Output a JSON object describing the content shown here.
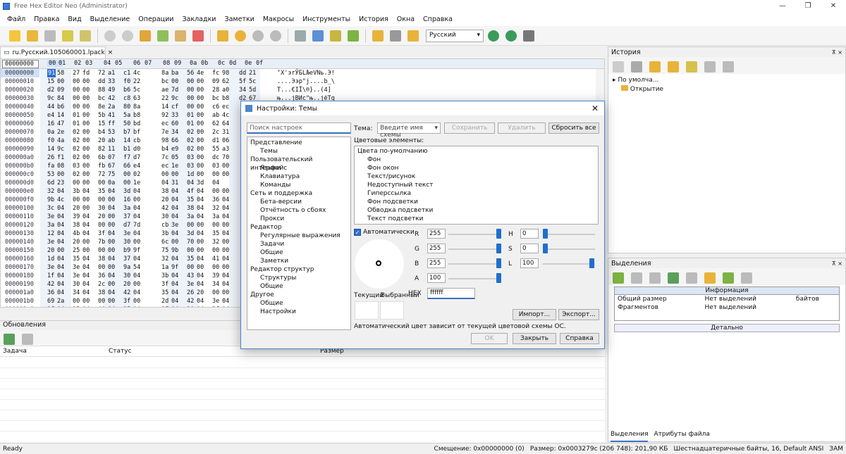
{
  "window": {
    "title": "Free Hex Editor Neo (Administrator)"
  },
  "menu": [
    "Файл",
    "Правка",
    "Вид",
    "Выделение",
    "Операции",
    "Закладки",
    "Заметки",
    "Макросы",
    "Инструменты",
    "История",
    "Окна",
    "Справка"
  ],
  "toolbar": {
    "language": "Русский"
  },
  "doc_tab": {
    "label": "ru.Русский.105060001.lpack",
    "close": "×"
  },
  "hex": {
    "offset_header": "00000000",
    "col_headers": [
      "00",
      "01",
      "02",
      "03",
      "04",
      "05",
      "06",
      "07",
      "08",
      "09",
      "0a",
      "0b",
      "0c",
      "0d",
      "0e",
      "0f"
    ],
    "offsets": [
      "00000000",
      "00000010",
      "00000020",
      "00000030",
      "00000040",
      "00000050",
      "00000060",
      "00000070",
      "00000080",
      "00000090",
      "000000a0",
      "000000b0",
      "000000c0",
      "000000d0",
      "000000e0",
      "000000f0",
      "00000100",
      "00000110",
      "00000120",
      "00000130",
      "00000140",
      "00000150",
      "00000160",
      "00000170",
      "00000180",
      "00000190",
      "000001a0",
      "000001b0",
      "000001c0",
      "000001d0",
      "000001e0"
    ],
    "rows": [
      [
        "91",
        "58",
        "27",
        "fd",
        "72",
        "a1",
        "c1",
        "4c",
        "8a",
        "ba",
        "56",
        "4e",
        "fc",
        "98",
        "dd",
        "21"
      ],
      [
        "15",
        "00",
        "00",
        "00",
        "dd",
        "33",
        "f0",
        "22",
        "bc",
        "00",
        "00",
        "00",
        "09",
        "62",
        "5f",
        "5c"
      ],
      [
        "d2",
        "09",
        "00",
        "00",
        "88",
        "49",
        "b6",
        "5c",
        "ae",
        "7d",
        "00",
        "00",
        "28",
        "a0",
        "34",
        "5d"
      ],
      [
        "9c",
        "84",
        "00",
        "00",
        "bc",
        "42",
        "c8",
        "63",
        "22",
        "9c",
        "00",
        "00",
        "bc",
        "b8",
        "d2",
        "67"
      ],
      [
        "44",
        "b6",
        "00",
        "00",
        "8e",
        "2a",
        "80",
        "8a",
        "14",
        "cf",
        "00",
        "00",
        "c6",
        "ec",
        "",
        "",
        ""
      ],
      [
        "e4",
        "14",
        "01",
        "00",
        "5b",
        "41",
        "5a",
        "b8",
        "92",
        "33",
        "01",
        "00",
        "ab",
        "4c",
        "",
        ""
      ],
      [
        "16",
        "47",
        "01",
        "00",
        "15",
        "ff",
        "50",
        "bd",
        "ec",
        "60",
        "01",
        "00",
        "62",
        "64",
        "",
        ""
      ],
      [
        "0a",
        "2e",
        "02",
        "00",
        "b4",
        "53",
        "b7",
        "bf",
        "7e",
        "34",
        "02",
        "00",
        "2c",
        "31",
        "",
        ""
      ],
      [
        "f0",
        "4a",
        "02",
        "00",
        "20",
        "ab",
        "14",
        "cb",
        "98",
        "66",
        "02",
        "00",
        "d1",
        "06",
        "",
        ""
      ],
      [
        "14",
        "9c",
        "02",
        "00",
        "82",
        "11",
        "b1",
        "d0",
        "b4",
        "e9",
        "02",
        "00",
        "55",
        "a3",
        "",
        ""
      ],
      [
        "26",
        "f1",
        "02",
        "00",
        "6b",
        "07",
        "f7",
        "d7",
        "7c",
        "05",
        "03",
        "00",
        "dc",
        "70",
        "",
        ""
      ],
      [
        "fa",
        "08",
        "03",
        "00",
        "fb",
        "67",
        "66",
        "e4",
        "ec",
        "1e",
        "03",
        "00",
        "03",
        "00",
        "",
        ""
      ],
      [
        "53",
        "00",
        "02",
        "00",
        "72",
        "75",
        "00",
        "02",
        "00",
        "00",
        "1d",
        "00",
        "00",
        "00",
        "",
        ""
      ],
      [
        "6d",
        "23",
        "00",
        "00",
        "00",
        "0a",
        "00",
        "1e",
        "04",
        "31",
        "04",
        "3d",
        "04",
        "",
        ""
      ],
      [
        "32",
        "04",
        "3b",
        "04",
        "35",
        "04",
        "3d",
        "04",
        "38",
        "04",
        "4f",
        "04",
        "00",
        "00",
        "",
        ""
      ],
      [
        "9b",
        "4c",
        "00",
        "00",
        "00",
        "00",
        "16",
        "00",
        "20",
        "04",
        "35",
        "04",
        "36",
        "04",
        "",
        ""
      ],
      [
        "3c",
        "04",
        "20",
        "00",
        "30",
        "04",
        "3a",
        "04",
        "42",
        "04",
        "38",
        "04",
        "32",
        "04",
        "",
        ""
      ],
      [
        "3e",
        "04",
        "39",
        "04",
        "20",
        "00",
        "37",
        "04",
        "30",
        "04",
        "3a",
        "04",
        "3a",
        "04",
        "",
        ""
      ],
      [
        "3a",
        "04",
        "38",
        "04",
        "00",
        "00",
        "d7",
        "7d",
        "cb",
        "3e",
        "00",
        "00",
        "00",
        "00",
        "",
        ""
      ],
      [
        "12",
        "04",
        "4b",
        "04",
        "3f",
        "04",
        "3e",
        "04",
        "3b",
        "04",
        "3d",
        "04",
        "35",
        "04",
        "",
        ""
      ],
      [
        "3e",
        "04",
        "20",
        "00",
        "7b",
        "00",
        "30",
        "00",
        "6c",
        "00",
        "70",
        "00",
        "32",
        "00",
        "",
        ""
      ],
      [
        "20",
        "00",
        "25",
        "00",
        "00",
        "00",
        "b9",
        "9f",
        "75",
        "9b",
        "00",
        "00",
        "00",
        "00",
        "",
        ""
      ],
      [
        "1d",
        "04",
        "35",
        "04",
        "38",
        "04",
        "37",
        "04",
        "32",
        "04",
        "35",
        "04",
        "41",
        "04",
        "",
        ""
      ],
      [
        "3e",
        "04",
        "3e",
        "04",
        "00",
        "00",
        "9a",
        "54",
        "1a",
        "9f",
        "00",
        "00",
        "00",
        "00",
        "",
        ""
      ],
      [
        "1f",
        "04",
        "3e",
        "04",
        "36",
        "04",
        "30",
        "04",
        "3b",
        "04",
        "43",
        "04",
        "39",
        "04",
        "",
        ""
      ],
      [
        "42",
        "04",
        "30",
        "04",
        "2c",
        "00",
        "20",
        "00",
        "3f",
        "04",
        "3e",
        "04",
        "34",
        "04",
        "",
        ""
      ],
      [
        "36",
        "04",
        "34",
        "04",
        "38",
        "04",
        "42",
        "04",
        "35",
        "04",
        "26",
        "20",
        "00",
        "00",
        "",
        ""
      ],
      [
        "69",
        "2a",
        "00",
        "00",
        "00",
        "00",
        "3f",
        "00",
        "2d",
        "04",
        "42",
        "04",
        "3e",
        "04",
        "",
        ""
      ],
      [
        "3f",
        "04",
        "35",
        "04",
        "40",
        "04",
        "35",
        "04",
        "37",
        "04",
        "30",
        "04",
        "3f",
        "04",
        "",
        ""
      ],
      [
        "41",
        "04",
        "42",
        "04",
        "38",
        "04",
        "42",
        "04",
        "20",
        "00",
        "32",
        "04",
        "41",
        "04",
        "",
        ""
      ],
      [
        "1b",
        "04",
        "3e",
        "04",
        "38",
        "04",
        "34",
        "04",
        "20",
        "00",
        "32",
        "04",
        "42",
        "04",
        "",
        ""
      ]
    ],
    "text": [
      "‘X'эrЎБLЉeVNь.Э!",
      "....Ээр\"j....b_\\",
      "Т...€ІЇ\\®}..(4]",
      "њ...јBИc\"њ..јёТg"
    ]
  },
  "updates": {
    "title": "Обновления",
    "cols": [
      "Задача",
      "Статус",
      "Размер"
    ]
  },
  "history": {
    "title": "История",
    "pin": "⊼ ×",
    "root": "По умолча...",
    "child": "Открытие"
  },
  "selection": {
    "title": "Выделения",
    "pin": "⊼ ×",
    "info_header": "Информация",
    "rows": [
      [
        "Общий размер",
        "Нет выделений",
        "байтов"
      ],
      [
        "Фрагментов",
        "Нет выделений",
        ""
      ]
    ],
    "detail": "Детально"
  },
  "bottom_tabs": [
    "Выделения",
    "Атрибуты файла"
  ],
  "status": {
    "ready": "Ready",
    "offset": "Смещение: 0x00000000 (0)",
    "size": "Размер: 0x0003279c (206 748): 201,90 КБ",
    "mode": "Шестнадцатеричные байты, 16, Default ANSI",
    "ins": "ЗАМ"
  },
  "dialog": {
    "title": "Настройки: Темы",
    "close": "✕",
    "search_placeholder": "Поиск настроек",
    "nav": [
      {
        "label": "Представление",
        "sub": false
      },
      {
        "label": "Темы",
        "sub": true
      },
      {
        "label": "Пользовательский интерфейс",
        "sub": false
      },
      {
        "label": "Языки",
        "sub": true
      },
      {
        "label": "Клавиатура",
        "sub": true
      },
      {
        "label": "Команды",
        "sub": true
      },
      {
        "label": "Сеть и поддержка",
        "sub": false
      },
      {
        "label": "Бета-версии",
        "sub": true
      },
      {
        "label": "Отчётность о сбоях",
        "sub": true
      },
      {
        "label": "Прокси",
        "sub": true
      },
      {
        "label": "Редактор",
        "sub": false
      },
      {
        "label": "Регулярные выражения",
        "sub": true
      },
      {
        "label": "Задачи",
        "sub": true
      },
      {
        "label": "Общие",
        "sub": true
      },
      {
        "label": "Заметки",
        "sub": true
      },
      {
        "label": "Редактор структур",
        "sub": false
      },
      {
        "label": "Структуры",
        "sub": true
      },
      {
        "label": "Общие",
        "sub": true
      },
      {
        "label": "Другое",
        "sub": false
      },
      {
        "label": "Общие",
        "sub": true
      },
      {
        "label": "Настройки",
        "sub": true
      }
    ],
    "theme_label": "Тема:",
    "theme_placeholder": "Введите имя схемы",
    "save": "Сохранить",
    "delete": "Удалить",
    "reset": "Сбросить все",
    "elements_label": "Цветовые элементы:",
    "elements": [
      {
        "label": "Цвета по-умолчанию",
        "sub": false
      },
      {
        "label": "Фон",
        "sub": true
      },
      {
        "label": "Фон окон",
        "sub": true
      },
      {
        "label": "Текст/рисунок",
        "sub": true
      },
      {
        "label": "Недоступный текст",
        "sub": true
      },
      {
        "label": "Гиперссылка",
        "sub": true
      },
      {
        "label": "Фон подсветки",
        "sub": true
      },
      {
        "label": "Обводка подсветки",
        "sub": true
      },
      {
        "label": "Текст подсветки",
        "sub": true
      }
    ],
    "auto": "Автоматически",
    "rgba": [
      {
        "k": "R",
        "v": "255"
      },
      {
        "k": "G",
        "v": "255"
      },
      {
        "k": "B",
        "v": "255"
      },
      {
        "k": "A",
        "v": "100"
      }
    ],
    "hsl": [
      {
        "k": "H",
        "v": "0"
      },
      {
        "k": "S",
        "v": "0"
      },
      {
        "k": "L",
        "v": "100"
      }
    ],
    "current": "Текущий",
    "selected": "Выбранный",
    "hex_label": "HEX",
    "hex_value": "ffffff",
    "import": "Импорт...",
    "export": "Экспорт...",
    "note": "Автоматический цвет зависит от текущей цветовой схемы ОС.",
    "ok": "OK",
    "close_btn": "Закрыть",
    "help": "Справка"
  }
}
